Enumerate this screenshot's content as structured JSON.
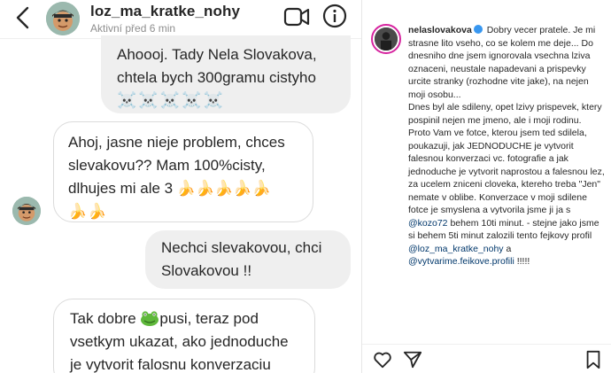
{
  "dm": {
    "header": {
      "username": "loz_ma_kratke_nohy",
      "status": "Aktivní před 6 min"
    },
    "messages": [
      {
        "direction": "outgoing",
        "lines": [
          "Ahoooj. Tady Nela Slovakova,",
          "chtela bych 300gramu cistyho"
        ],
        "emoji": "☠️☠️☠️☠️☠️"
      },
      {
        "direction": "incoming",
        "lines": [
          "Ahoj, jasne nieje problem, chces",
          "slevakovu?? Mam 100%cisty,",
          "dlhujes mi ale 3 🍌🍌🍌🍌🍌"
        ],
        "emoji": "🍌🍌"
      },
      {
        "direction": "outgoing",
        "lines": [
          "Nechci slevakovou, chci",
          "Slovakovou !!"
        ]
      },
      {
        "direction": "incoming",
        "lead": "Tak dobre",
        "lead_tail": "pusi, teraz pod",
        "lines": [
          "vsetkym ukazat, ako jednoduche",
          "je vytvorit falosnu  konverzaciu"
        ]
      }
    ]
  },
  "post": {
    "username": "nelaslovakova",
    "caption_intro": "Dobry vecer pratele. Je mi strasne lito vseho, co se kolem me deje... Do dnesniho dne jsem ignorovala vsechna lziva oznaceni, neustale napadevani a prispevky urcite stranky (rozhodne vite jake), na nejen moji osobu...",
    "caption_p2": "Dnes byl ale sdileny, opet lzivy prispevek, ktery pospinil nejen me jmeno, ale i moji rodinu.",
    "caption_p3_a": "Proto Vam ve fotce, kterou jsem ted sdilela, poukazuji, jak JEDNODUCHE je vytvorit falesnou konverzaci vc. fotografie a jak jednoduche je vytvorit naprostou a falesnou lez, za ucelem zniceni cloveka, ktereho treba \"Jen\" nemate v oblibe. Konverzace v moji sdilene fotce je smyslena a vytvorila jsme ji ja s",
    "mention1": "@kozo72",
    "caption_p3_b": "behem 10ti minut. - stejne jako jsme si behem 5ti minut zalozili tento fejkovy profil",
    "mention2": "@loz_ma_kratke_nohy",
    "and": "a",
    "mention3": "@vytvarime.feikove.profili",
    "tail": "!!!!!"
  },
  "icons": {
    "back": "chevron-left-icon",
    "video": "video-camera-icon",
    "info": "info-icon",
    "like": "heart-icon",
    "share": "paper-plane-icon",
    "save": "bookmark-icon"
  },
  "colors": {
    "outgoing_bubble": "#efefef",
    "incoming_border": "#dbdbdb",
    "mention": "#00376b",
    "verified": "#3897f0"
  }
}
